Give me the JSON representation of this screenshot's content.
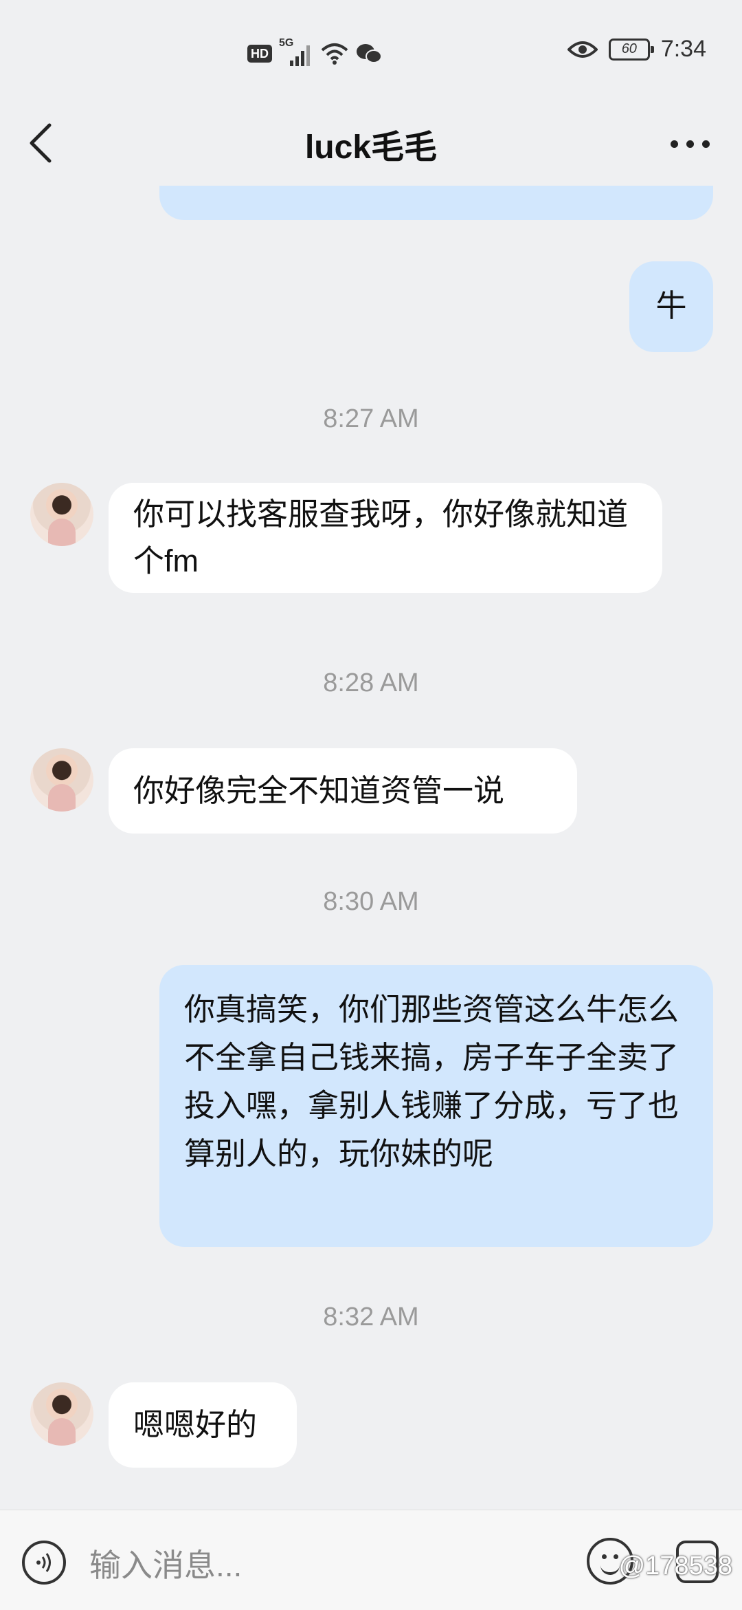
{
  "status_bar": {
    "hd": "HD",
    "network": "5G",
    "battery": "60",
    "time": "7:34"
  },
  "header": {
    "title": "luck毛毛"
  },
  "messages": [
    {
      "type": "out",
      "text": "牛"
    },
    {
      "type": "time",
      "text": "8:27 AM"
    },
    {
      "type": "in",
      "text": "你可以找客服查我呀，你好像就知道个fm"
    },
    {
      "type": "time",
      "text": "8:28 AM"
    },
    {
      "type": "in",
      "text": "你好像完全不知道资管一说"
    },
    {
      "type": "time",
      "text": "8:30 AM"
    },
    {
      "type": "out",
      "text": "你真搞笑，你们那些资管这么牛怎么不全拿自己钱来搞，房子车子全卖了投入嘿，拿别人钱赚了分成，亏了也算别人的，玩你妹的呢"
    },
    {
      "type": "time",
      "text": "8:32 AM"
    },
    {
      "type": "in",
      "text": "嗯嗯好的"
    }
  ],
  "input": {
    "placeholder": "输入消息..."
  },
  "watermark": "@178538"
}
